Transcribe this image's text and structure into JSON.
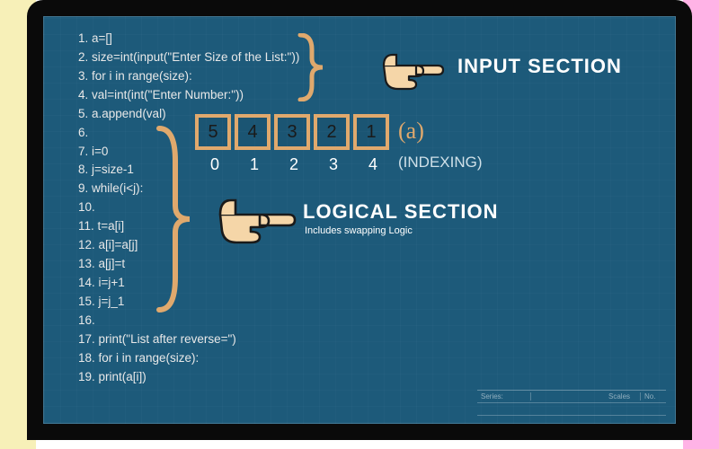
{
  "code_lines": [
    "1. a=[]",
    "2. size=int(input(\"Enter Size of the List:\"))",
    "3. for i in range(size):",
    "4. val=int(int(\"Enter Number:\"))",
    "5. a.append(val)",
    "6.",
    "7. i=0",
    "8. j=size-1",
    "9. while(i<j):",
    "10.",
    "11. t=a[i]",
    "12. a[i]=a[j]",
    "13. a[j]=t",
    "14. i=j+1",
    "15. j=j_1",
    "16.",
    "17. print(\"List after reverse=\")",
    "18. for i in range(size):",
    "19. print(a[i])"
  ],
  "labels": {
    "input_section": "INPUT SECTION",
    "logical_section": "LOGICAL SECTION",
    "logical_sub": "Includes swapping Logic",
    "array_name": "(a)",
    "indexing": "(INDEXING)"
  },
  "array": {
    "cells": [
      "5",
      "4",
      "3",
      "2",
      "1"
    ],
    "indices": [
      "0",
      "1",
      "2",
      "3",
      "4"
    ]
  },
  "title_block": {
    "series": "Series:",
    "scales": "Scales",
    "no": "No."
  },
  "colors": {
    "screen": "#1d5a7a",
    "brace": "#e0a96d",
    "hand_fill": "#f5d6a8",
    "hand_stroke": "#1a1a1a"
  }
}
